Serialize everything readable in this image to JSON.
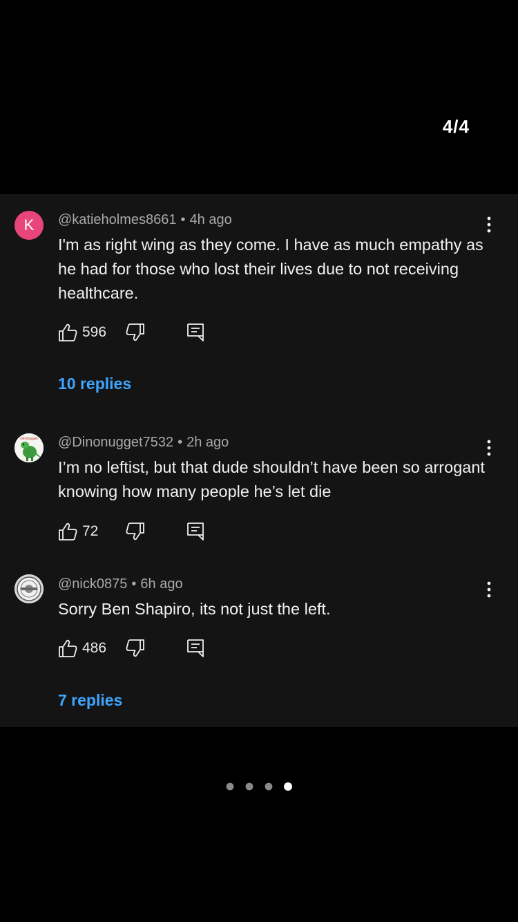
{
  "header": {
    "counter": "4/4"
  },
  "comments": [
    {
      "avatar_letter": "K",
      "avatar_color": "#e8467a",
      "username": "@katieholmes8661",
      "time": "4h ago",
      "text": "I'm as right wing as they come. I have as much empathy as he had for those who lost their lives due to not receiving healthcare.",
      "likes": "596",
      "replies": "10 replies"
    },
    {
      "avatar_icon": "dinosaur-avatar-icon",
      "username": "@Dinonugget7532",
      "time": "2h ago",
      "text": "I’m no leftist, but that dude shouldn’t have been so arrogant knowing how many people he’s let die",
      "likes": "72"
    },
    {
      "avatar_icon": "seal-avatar-icon",
      "username": "@nick0875",
      "time": "6h ago",
      "text": "Sorry Ben Shapiro, its not just the left.",
      "likes": "486",
      "replies": "7 replies"
    }
  ],
  "pagination": {
    "total": 4,
    "active": 4
  },
  "colors": {
    "accent_link": "#3ea6ff",
    "panel_bg": "#141414"
  }
}
